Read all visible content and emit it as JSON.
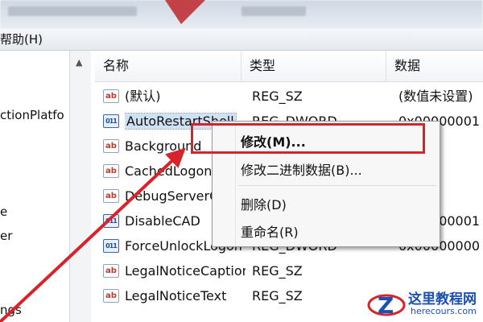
{
  "menubar": {
    "help": "帮助(H)"
  },
  "tree": {
    "items": [
      "ctionPlatfo",
      "e",
      "er",
      "ngs"
    ]
  },
  "list": {
    "headers": {
      "name": "名称",
      "type": "类型",
      "data": "数据"
    },
    "rows": [
      {
        "name": "(默认)",
        "type": "REG_SZ",
        "data": "(数值未设置)",
        "icon": "string-value-icon"
      },
      {
        "name": "AutoRestartShell",
        "type": "REG_DWORD",
        "data": "0x00000001",
        "icon": "dword-value-icon"
      },
      {
        "name": "Background",
        "type": "",
        "data": "",
        "icon": "string-value-icon"
      },
      {
        "name": "CachedLogonsCount",
        "type": "",
        "data": "",
        "icon": "string-value-icon"
      },
      {
        "name": "DebugServerCommand",
        "type": "",
        "data": "",
        "icon": "string-value-icon"
      },
      {
        "name": "DisableCAD",
        "type": "",
        "data": "0x00000001",
        "icon": "dword-value-icon"
      },
      {
        "name": "ForceUnlockLogon",
        "type": "REG_DWORD",
        "data": "0x00000000",
        "icon": "dword-value-icon"
      },
      {
        "name": "LegalNoticeCaption",
        "type": "REG_SZ",
        "data": "",
        "icon": "string-value-icon"
      },
      {
        "name": "LegalNoticeText",
        "type": "REG_SZ",
        "data": "",
        "icon": "string-value-icon"
      }
    ]
  },
  "context_menu": {
    "items": [
      "修改(M)...",
      "修改二进制数据(B)...",
      "删除(D)",
      "重命名(R)"
    ]
  },
  "watermark": {
    "title": "这里教程网",
    "url": "herecours.com"
  },
  "colors": {
    "annotation_red": "#d8232a",
    "selection": "#cfe1f5"
  }
}
